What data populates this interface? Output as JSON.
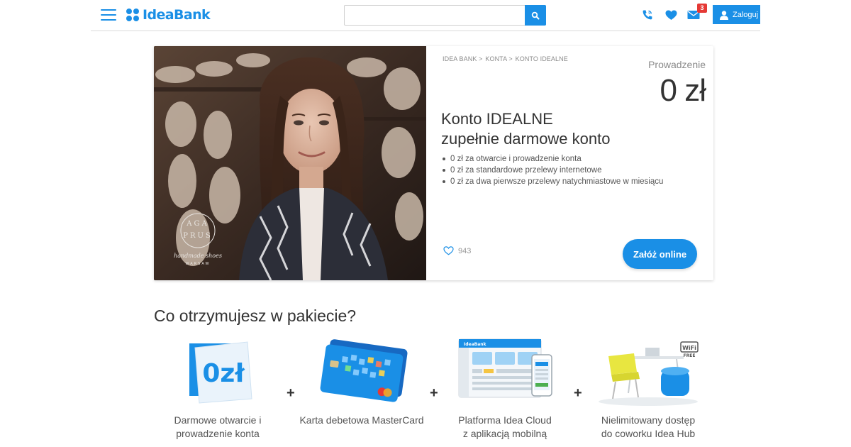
{
  "header": {
    "brand": "IdeaBank",
    "search": {
      "value": "",
      "placeholder": ""
    },
    "mail_badge": "3",
    "login_label": "Zaloguj"
  },
  "hero": {
    "breadcrumb": [
      "IDEA BANK >",
      "KONTA >",
      "KONTO IDEALNE"
    ],
    "fee_label": "Prowadzenie",
    "fee_value": "0 zł",
    "title_line1": "Konto IDEALNE",
    "title_line2": "zupełnie darmowe konto",
    "features": [
      "0 zł za otwarcie i prowadzenie konta",
      "0 zł za standardowe przelewy internetowe",
      "0 zł za dwa pierwsze przelewy natychmiastowe w miesiącu"
    ],
    "likes": "943",
    "cta_label": "Załóż online",
    "photo_logo": {
      "letters": "AGA PRUS",
      "script": "handmade shoes",
      "city": "WARSAW"
    }
  },
  "package": {
    "title": "Co otrzymujesz w pakiecie?",
    "items": [
      {
        "line1": "Darmowe otwarcie i",
        "line2": "prowadzenie konta",
        "icon": "zero-pln-icon",
        "image_text": "0zł"
      },
      {
        "line1": "Karta debetowa MasterCard",
        "line2": "",
        "icon": "debit-card-icon"
      },
      {
        "line1": "Platforma Idea Cloud",
        "line2": "z aplikacją mobilną",
        "icon": "cloud-platform-icon",
        "image_text": "IdeaBank"
      },
      {
        "line1": "Nielimitowany dostęp",
        "line2": "do coworku Idea Hub",
        "icon": "coworking-icon",
        "image_text": "WiFi",
        "image_sub": "FREE"
      }
    ],
    "plus_sign": "+"
  },
  "colors": {
    "brand": "#1a8fe6",
    "badge": "#e53935",
    "text": "#333333"
  }
}
